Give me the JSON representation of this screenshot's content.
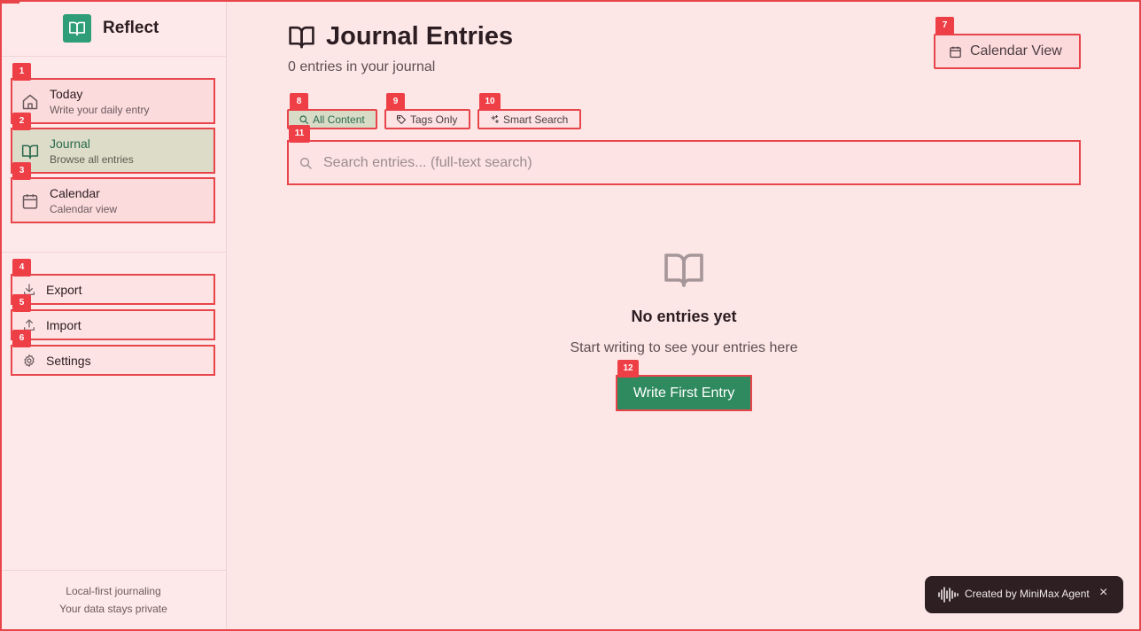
{
  "app": {
    "name": "Reflect",
    "brand_color": "#2f9d77",
    "accent": "#e8454b"
  },
  "sidebar": {
    "nav": [
      {
        "badge": "1",
        "title": "Today",
        "subtitle": "Write your daily entry",
        "icon": "home-icon",
        "active": false
      },
      {
        "badge": "2",
        "title": "Journal",
        "subtitle": "Browse all entries",
        "icon": "book-icon",
        "active": true
      },
      {
        "badge": "3",
        "title": "Calendar",
        "subtitle": "Calendar view",
        "icon": "calendar-icon",
        "active": false
      }
    ],
    "utilities": [
      {
        "badge": "4",
        "label": "Export",
        "icon": "download-icon"
      },
      {
        "badge": "5",
        "label": "Import",
        "icon": "upload-icon"
      },
      {
        "badge": "6",
        "label": "Settings",
        "icon": "gear-icon"
      }
    ],
    "footer": {
      "line1": "Local-first journaling",
      "line2": "Your data stays private"
    }
  },
  "main": {
    "title": "Journal Entries",
    "count_text": "0 entries in your journal",
    "calendar_button": {
      "badge": "7",
      "label": "Calendar View"
    },
    "filters": [
      {
        "badge": "8",
        "label": "All Content",
        "icon": "search-icon",
        "active": true
      },
      {
        "badge": "9",
        "label": "Tags Only",
        "icon": "tag-icon",
        "active": false
      },
      {
        "badge": "10",
        "label": "Smart Search",
        "icon": "sparkle-icon",
        "active": false
      }
    ],
    "search": {
      "badge": "11",
      "placeholder": "Search entries... (full-text search)",
      "value": ""
    },
    "empty": {
      "title": "No entries yet",
      "subtitle": "Start writing to see your entries here",
      "button_badge": "12",
      "button_label": "Write First Entry"
    }
  },
  "toast": {
    "label": "Created by MiniMax Agent",
    "close": "×"
  }
}
